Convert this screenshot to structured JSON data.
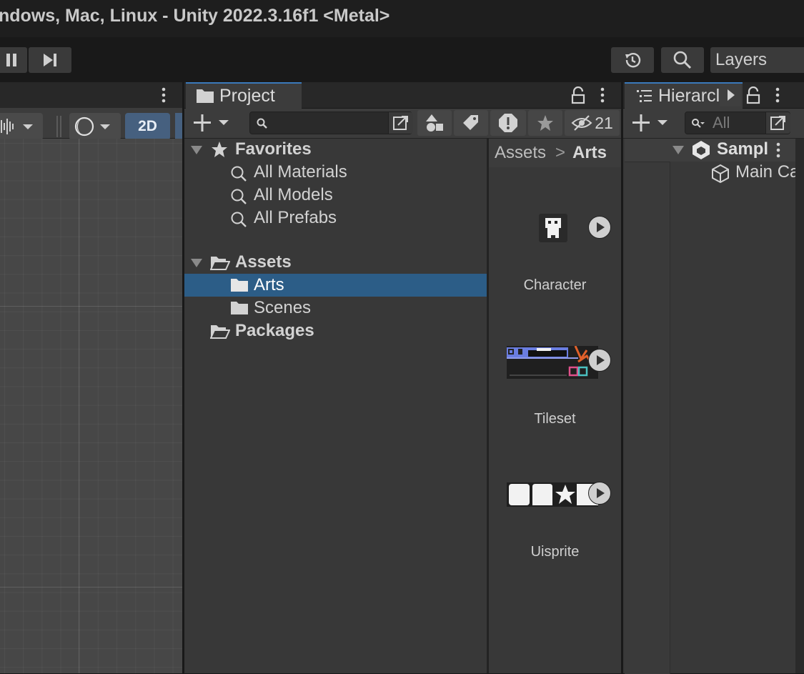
{
  "window": {
    "title": "ndows, Mac, Linux - Unity 2022.3.16f1 <Metal>"
  },
  "toolbar": {
    "layers_label": "Layers",
    "pause_icon": "pause-icon",
    "step_icon": "step-icon",
    "history_icon": "history-icon",
    "search_icon": "search-icon"
  },
  "scene": {
    "mode_2d_label": "2D"
  },
  "project": {
    "tab_label": "Project",
    "hidden_count": "21",
    "search": {
      "value": "",
      "placeholder": ""
    },
    "tree": {
      "favorites": {
        "label": "Favorites",
        "items": [
          {
            "label": "All Materials"
          },
          {
            "label": "All Models"
          },
          {
            "label": "All Prefabs"
          }
        ]
      },
      "assets": {
        "label": "Assets",
        "children": [
          {
            "label": "Arts",
            "selected": true
          },
          {
            "label": "Scenes",
            "selected": false
          }
        ]
      },
      "packages": {
        "label": "Packages"
      }
    },
    "breadcrumb": {
      "root": "Assets",
      "separator": ">",
      "current": "Arts"
    },
    "assets_grid": [
      {
        "name": "Character"
      },
      {
        "name": "Tileset"
      },
      {
        "name": "Uisprite"
      }
    ]
  },
  "hierarchy": {
    "tab_label": "Hierarcl",
    "search": {
      "placeholder": "All"
    },
    "scene_label": "Sampl",
    "object_label": "Main Ca"
  },
  "colors": {
    "accent": "#3a79bb",
    "selection": "#2c5d87",
    "panel": "#383838",
    "toolbar": "#3c3c3c"
  }
}
